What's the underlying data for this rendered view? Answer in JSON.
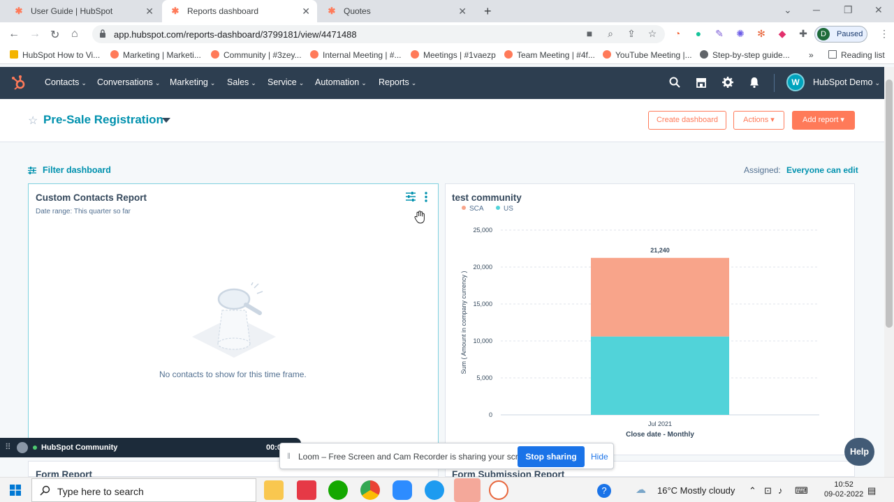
{
  "browser": {
    "tabs": [
      {
        "title": "User Guide | HubSpot"
      },
      {
        "title": "Reports dashboard"
      },
      {
        "title": "Quotes"
      }
    ],
    "url": "app.hubspot.com/reports-dashboard/3799181/view/4471488",
    "profile_initial": "D",
    "profile_status": "Paused",
    "bookmarks": [
      "HubSpot How to Vi...",
      "Marketing | Marketi...",
      "Community | #3zey...",
      "Internal Meeting | #...",
      "Meetings | #1vaezp",
      "Team Meeting | #4f...",
      "YouTube Meeting |...",
      "Step-by-step guide..."
    ],
    "reading_list": "Reading list"
  },
  "nav": {
    "items": [
      "Contacts",
      "Conversations",
      "Marketing",
      "Sales",
      "Service",
      "Automation",
      "Reports"
    ],
    "account_initial": "W",
    "account_name": "HubSpot Demo"
  },
  "dashboard": {
    "title": "Pre-Sale Registration",
    "create_label": "Create dashboard",
    "actions_label": "Actions ▾",
    "add_report_label": "Add report ▾",
    "filter_label": "Filter dashboard",
    "assigned_label": "Assigned:",
    "assigned_value": "Everyone can edit"
  },
  "cards": {
    "contacts": {
      "title": "Custom Contacts Report",
      "date_range": "Date range: This quarter so far",
      "empty": "No contacts to show for this time frame."
    },
    "community": {
      "title": "test community"
    },
    "form_report": {
      "title": "Form Report"
    },
    "form_submission": {
      "title": "Form Submission Report"
    }
  },
  "chart_data": {
    "type": "bar",
    "title": "test community",
    "categories": [
      "Jul 2021"
    ],
    "series": [
      {
        "name": "SCA",
        "values": [
          10640
        ],
        "color": "#f8a48a"
      },
      {
        "name": "US",
        "values": [
          10600
        ],
        "color": "#51d3d9"
      }
    ],
    "total_labels": [
      "21,240"
    ],
    "xlabel": "Close date - Monthly",
    "ylabel": "Sum ( Amount in company currency )",
    "ylim": [
      0,
      25000
    ],
    "yticks": [
      "0",
      "5,000",
      "10,000",
      "15,000",
      "20,000",
      "25,000"
    ],
    "grid": true,
    "legend": "top-left"
  },
  "overlays": {
    "loom_title": "HubSpot Community",
    "loom_time": "00:0",
    "share_text": "Loom – Free Screen and Cam Recorder is sharing your screen.",
    "stop_label": "Stop sharing",
    "hide_label": "Hide",
    "help_label": "Help"
  },
  "taskbar": {
    "search_placeholder": "Type here to search",
    "weather": "16°C  Mostly cloudy",
    "time": "10:52",
    "date": "09-02-2022"
  }
}
